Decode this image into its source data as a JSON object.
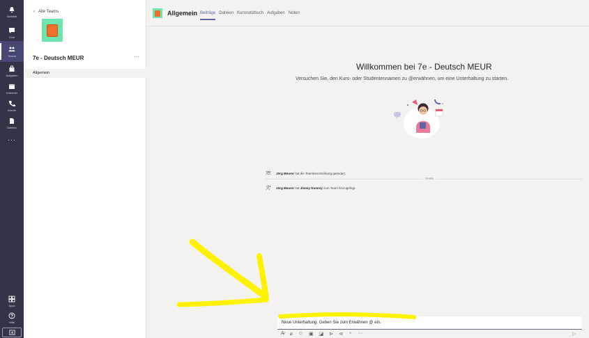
{
  "rail": {
    "items": [
      {
        "label": "Aktivität",
        "icon": "bell-icon"
      },
      {
        "label": "Chat",
        "icon": "chat-icon"
      },
      {
        "label": "Teams",
        "icon": "teams-icon"
      },
      {
        "label": "Aufgaben",
        "icon": "assignments-icon"
      },
      {
        "label": "Kalender",
        "icon": "calendar-icon"
      },
      {
        "label": "Anrufe",
        "icon": "phone-icon"
      },
      {
        "label": "Dateien",
        "icon": "file-icon"
      }
    ],
    "more": "···",
    "bottom_items": [
      {
        "label": "Apps",
        "icon": "apps-icon"
      },
      {
        "label": "Hilfe",
        "icon": "help-icon"
      }
    ]
  },
  "panel": {
    "back_label": "Alle Teams",
    "team_name": "7e - Deutsch MEUR",
    "more": "···",
    "channel": "Allgemein"
  },
  "header": {
    "title": "Allgemein",
    "tabs": [
      "Beiträge",
      "Dateien",
      "Kursnotizbuch",
      "Aufgaben",
      "Noten"
    ]
  },
  "welcome": {
    "title": "Willkommen bei 7e - Deutsch MEUR",
    "subtitle": "Versuchen Sie, den Kurs- oder Studentennamen zu @erwähnen, um eine Unterhaltung zu starten."
  },
  "feed": {
    "divider": "Heute",
    "events": [
      {
        "actor": "Jörg Meurer",
        "text": " hat die Teambeschreibung geändert."
      },
      {
        "actor": "Jörg Meurer",
        "text": " hat ",
        "target": "Jimmy Dummy",
        "text2": " zum Team hinzugefügt."
      }
    ]
  },
  "compose": {
    "placeholder": "Neue Unterhaltung. Geben Sie zum Erwähnen @ ein.",
    "toolbar": [
      "format-icon",
      "attach-icon",
      "emoji-icon",
      "gif-icon",
      "sticker-icon",
      "meet-icon",
      "stream-icon",
      "praise-icon",
      "more-icon"
    ]
  },
  "colors": {
    "rail": "#33344a",
    "accent": "#6264a7",
    "team_tile": "#6ee5b1",
    "team_logo": "#ef6f2a",
    "annotation": "#fff200"
  }
}
